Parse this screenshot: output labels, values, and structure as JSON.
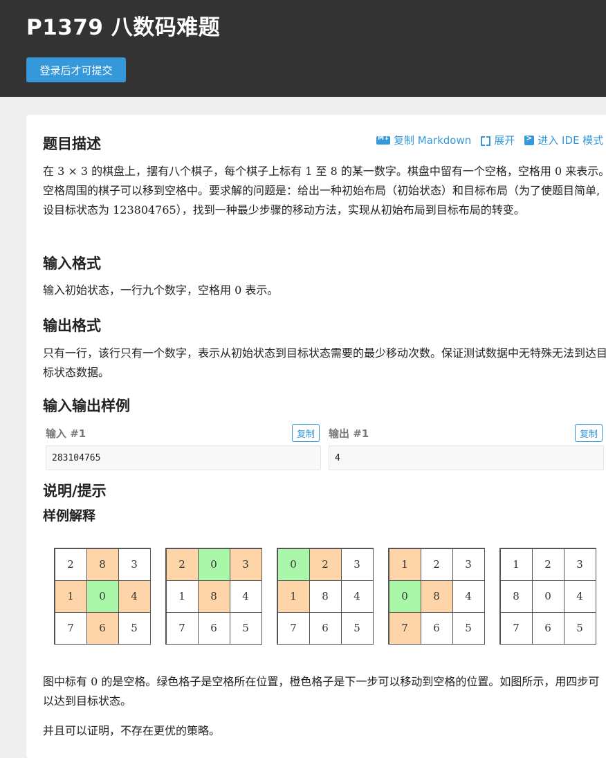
{
  "header": {
    "title": "P1379 八数码难题",
    "submit_label": "登录后才可提交"
  },
  "actions": {
    "copy_markdown": "复制 Markdown",
    "expand": "展开",
    "ide_mode": "进入 IDE 模式"
  },
  "sections": {
    "description_title": "题目描述",
    "description_parts": [
      "在 ",
      "3 × 3",
      " 的棋盘上，摆有八个棋子，每个棋子上标有 ",
      "1",
      " 至 ",
      "8",
      " 的某一数字。棋盘中留有一个空格，空格用 ",
      "0",
      " 来表示。空格周围的棋子可以移到空格中。要求解的问题是：给出一种初始布局（初始状态）和目标布局（为了使题目简单,设目标状态为 ",
      "123804765",
      "），找到一种最少步骤的移动方法，实现从初始布局到目标布局的转变。"
    ],
    "input_title": "输入格式",
    "input_parts": [
      "输入初始状态，一行九个数字，空格用 ",
      "0",
      " 表示。"
    ],
    "output_title": "输出格式",
    "output_text": "只有一行，该行只有一个数字，表示从初始状态到目标状态需要的最少移动次数。保证测试数据中无特殊无法到达目标状态数据。",
    "samples_title": "输入输出样例",
    "hint_title": "说明/提示",
    "explain_title": "样例解释",
    "figure_parts": [
      "图中标有 ",
      "0",
      " 的是空格。绿色格子是空格所在位置，橙色格子是下一步可以移动到空格的位置。如图所示，用四步可以达到目标状态。"
    ],
    "proof_text": "并且可以证明，不存在更优的策略。"
  },
  "samples": {
    "input_label": "输入 #1",
    "output_label": "输出 #1",
    "copy_label": "复制",
    "input_value": "283104765",
    "output_value": "4"
  },
  "boards": [
    {
      "cells": [
        "2",
        "8",
        "3",
        "1",
        "0",
        "4",
        "7",
        "6",
        "5"
      ],
      "colors": [
        "",
        "o",
        "",
        "o",
        "g",
        "o",
        "",
        "o",
        ""
      ]
    },
    {
      "cells": [
        "2",
        "0",
        "3",
        "1",
        "8",
        "4",
        "7",
        "6",
        "5"
      ],
      "colors": [
        "o",
        "g",
        "o",
        "",
        "o",
        "",
        "",
        "",
        ""
      ]
    },
    {
      "cells": [
        "0",
        "2",
        "3",
        "1",
        "8",
        "4",
        "7",
        "6",
        "5"
      ],
      "colors": [
        "g",
        "o",
        "",
        "o",
        "",
        "",
        "",
        "",
        ""
      ]
    },
    {
      "cells": [
        "1",
        "2",
        "3",
        "0",
        "8",
        "4",
        "7",
        "6",
        "5"
      ],
      "colors": [
        "o",
        "",
        "",
        "g",
        "o",
        "",
        "o",
        "",
        ""
      ]
    },
    {
      "cells": [
        "1",
        "2",
        "3",
        "8",
        "0",
        "4",
        "7",
        "6",
        "5"
      ],
      "colors": [
        "",
        "",
        "",
        "",
        "",
        "",
        "",
        "",
        ""
      ]
    }
  ],
  "colors": {
    "header_bg": "#333333",
    "accent": "#3498db",
    "blank_cell": "#aaf7aa",
    "movable_cell": "#fdd5a9"
  }
}
